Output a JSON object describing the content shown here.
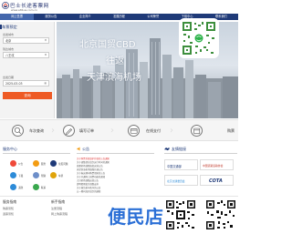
{
  "header": {
    "logo_text": "巴士长途客票网",
    "logo_url": "www.e8bus.com.cn"
  },
  "nav": {
    "items": [
      {
        "label": "网上售票",
        "active": true
      },
      {
        "label": "服务公告",
        "active": false
      },
      {
        "label": "企业简介",
        "active": false
      },
      {
        "label": "发展历程",
        "active": false
      },
      {
        "label": "公司荣誉",
        "active": false
      },
      {
        "label": "下载中心",
        "active": false
      },
      {
        "label": "联系我们",
        "active": false
      }
    ]
  },
  "booking": {
    "title": "车票预定",
    "from_label": "出发城市",
    "from_value": "北京",
    "to_label": "到达城市",
    "to_value": "八王坟",
    "date_label": "出发日期",
    "date_value": "2025-03-03",
    "search_label": "查询"
  },
  "banner": {
    "line1": "北京国贸CBD",
    "line2": "往返",
    "line3": "天津滨海机场"
  },
  "features": [
    {
      "label": "车次查询",
      "icon": "search-icon"
    },
    {
      "label": "填写订单",
      "icon": "pencil-icon"
    },
    {
      "label": "在线支付",
      "icon": "card-icon"
    },
    {
      "label": "购票",
      "icon": "ticket-icon"
    }
  ],
  "service": {
    "title": "服务中心",
    "items": [
      {
        "label": "公告",
        "color": "#ef4a3a"
      },
      {
        "label": "服务",
        "color": "#f39c12"
      },
      {
        "label": "常见问题",
        "color": "#1f3a78"
      },
      {
        "label": "下载",
        "color": "#2d8bd8"
      },
      {
        "label": "帮助",
        "color": "#6e8fc9"
      },
      {
        "label": "车票",
        "color": "#e0a40b"
      },
      {
        "label": "退款",
        "color": "#2d8bd8"
      },
      {
        "label": "联系",
        "color": "#3aa84e"
      }
    ]
  },
  "notice": {
    "title": "公告",
    "lines": [
      "关于购票系统维护升级的公告通知",
      "关于调整部分班次运行时间的通知",
      "首都机场线路恢复运营公告",
      "天津滨海机场线路开通公告",
      "关于春运期间购票须知的公告",
      "关于开通网上退票功能的通知",
      "大兴机场线路运营公告",
      "清明假期班次调整安排",
      "关于规范乘车秩序的公告",
      "五一期间加开班次的通知",
      "公交一卡通乘车相关公告",
      "关于实名制购票的通知"
    ]
  },
  "partners": {
    "title": "友情链接",
    "items": [
      "中国交通部",
      "中国道路运输协会",
      "北京交通委员会",
      "COTA"
    ]
  },
  "bottom": {
    "col1_title": "服务指南",
    "col1_items": [
      "购票须知",
      "退票须知"
    ],
    "col2_title": "新手指南",
    "col2_items": [
      "注册流程",
      "网上购票流程"
    ],
    "watermark": "便民店"
  },
  "colors": {
    "nav_blue": "#1f3a78",
    "accent_orange": "#ee5a24"
  }
}
